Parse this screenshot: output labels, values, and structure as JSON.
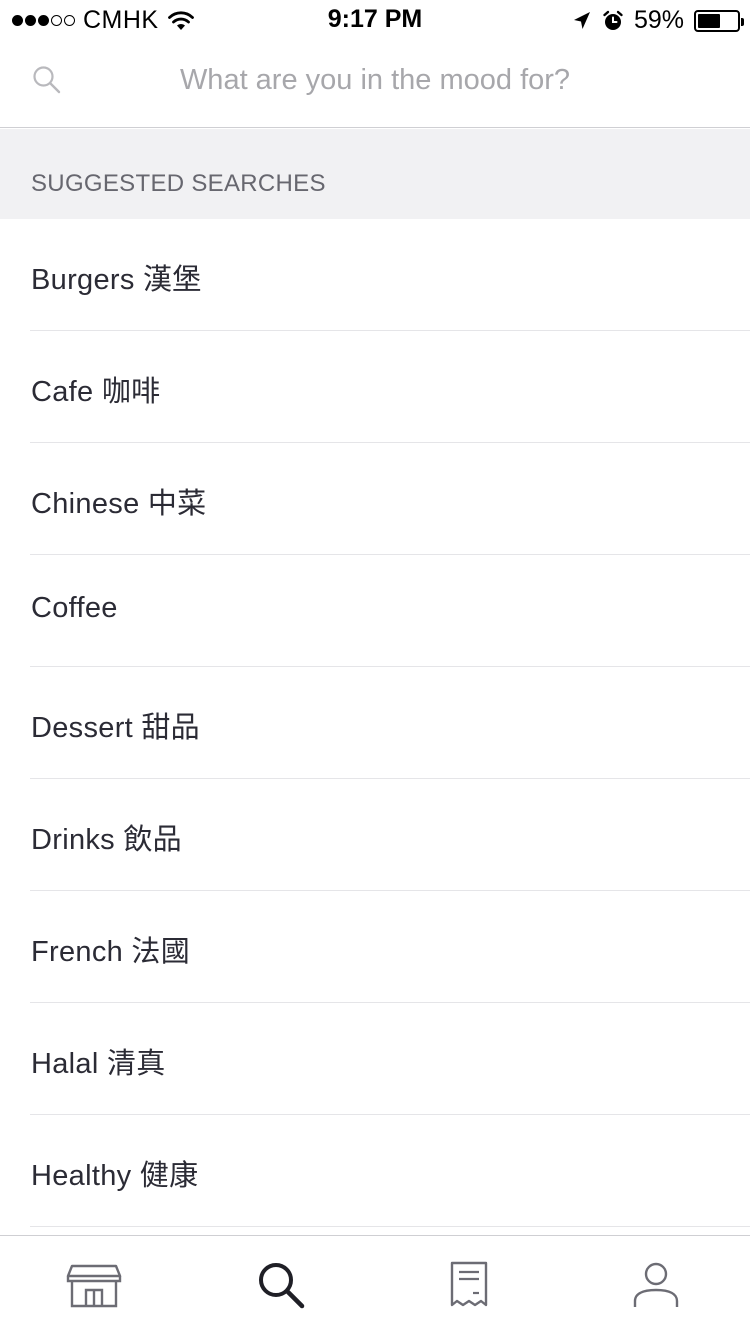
{
  "status_bar": {
    "carrier": "CMHK",
    "time": "9:17 PM",
    "battery_percent": "59%",
    "battery_level": 0.59,
    "signal_bars_filled": 3,
    "signal_bars_total": 5
  },
  "search": {
    "placeholder": "What are you in the mood for?",
    "value": ""
  },
  "suggested": {
    "header": "SUGGESTED SEARCHES",
    "items": [
      "Burgers 漢堡",
      "Cafe 咖啡",
      "Chinese 中菜",
      "Coffee",
      "Dessert 甜品",
      "Drinks 飲品",
      "French 法國",
      "Halal 清真",
      "Healthy 健康"
    ]
  },
  "tab_bar": {
    "tabs": [
      {
        "icon": "storefront-icon",
        "active": false
      },
      {
        "icon": "search-icon",
        "active": true
      },
      {
        "icon": "receipt-icon",
        "active": false
      },
      {
        "icon": "person-icon",
        "active": false
      }
    ]
  },
  "colors": {
    "text_primary": "#2b2b35",
    "placeholder": "#a7a7ab",
    "section_bg": "#f1f1f3",
    "icon_inactive": "#6c6c74",
    "icon_active": "#1f1f26"
  }
}
